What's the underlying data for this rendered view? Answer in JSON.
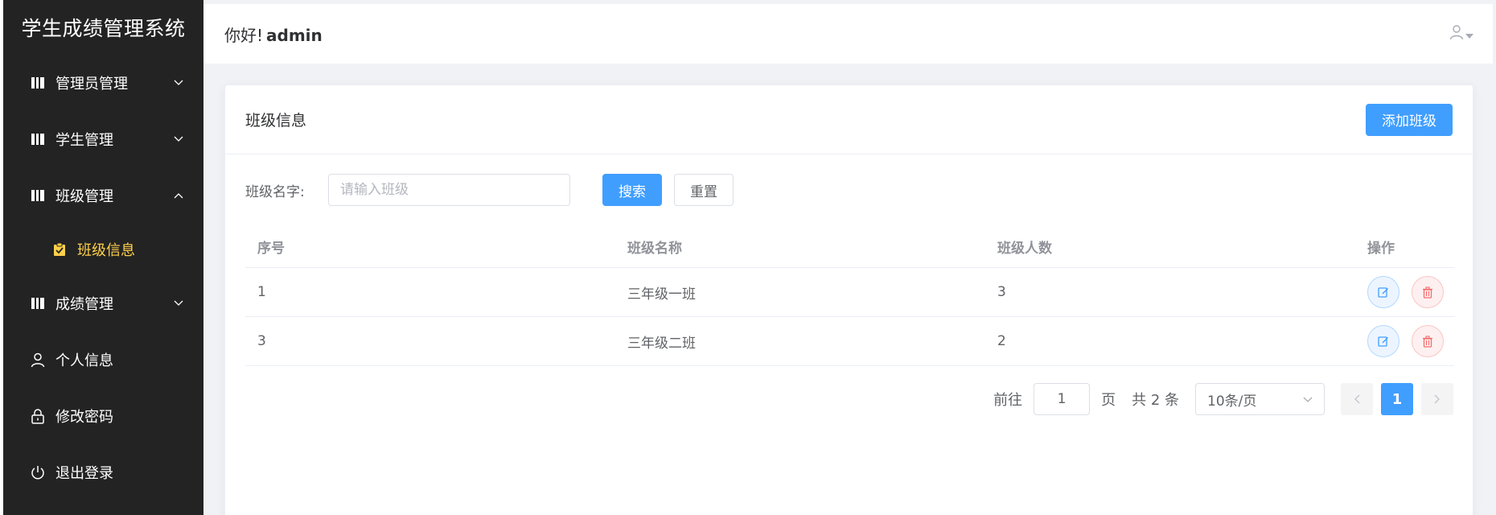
{
  "app": {
    "title": "学生成绩管理系统"
  },
  "sidebar": {
    "items": [
      {
        "label": "管理员管理",
        "icon": "building-icon",
        "expanded": false
      },
      {
        "label": "学生管理",
        "icon": "building-icon",
        "expanded": false
      },
      {
        "label": "班级管理",
        "icon": "building-icon",
        "expanded": true
      },
      {
        "label": "成绩管理",
        "icon": "building-icon",
        "expanded": false
      },
      {
        "label": "个人信息",
        "icon": "user-icon"
      },
      {
        "label": "修改密码",
        "icon": "lock-icon"
      },
      {
        "label": "退出登录",
        "icon": "power-icon"
      }
    ],
    "sub_items": [
      {
        "label": "班级信息",
        "icon": "clipboard-check-icon",
        "active": true
      }
    ],
    "active_color": "#ffd04b",
    "bg_color": "#232323"
  },
  "header": {
    "greeting": "你好!",
    "username": "admin",
    "user_menu_icon": "user-icon"
  },
  "card": {
    "title": "班级信息",
    "add_button": "添加班级"
  },
  "search": {
    "label": "班级名字:",
    "placeholder": "请输入班级",
    "value": "",
    "search_button": "搜索",
    "reset_button": "重置"
  },
  "table": {
    "columns": [
      "序号",
      "班级名称",
      "班级人数",
      "操作"
    ],
    "rows": [
      {
        "id": "1",
        "name": "三年级一班",
        "count": "3"
      },
      {
        "id": "3",
        "name": "三年级二班",
        "count": "2"
      }
    ]
  },
  "pagination": {
    "goto_label": "前往",
    "goto_value": "1",
    "page_unit": "页",
    "total": "共 2 条",
    "page_size": "10条/页",
    "current_page": "1"
  },
  "colors": {
    "primary": "#409eff",
    "danger": "#f56c6c"
  }
}
